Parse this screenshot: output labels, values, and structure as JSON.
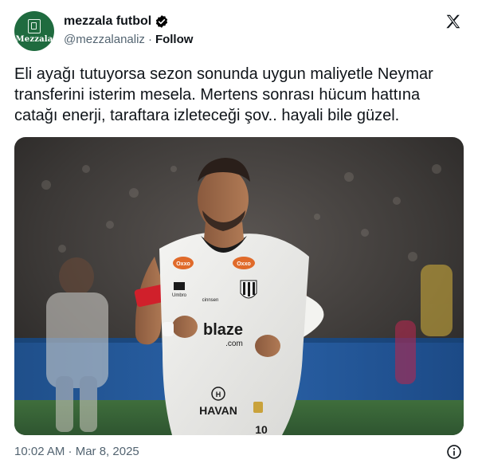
{
  "author": {
    "display_name": "mezzala futbol",
    "handle": "@mezzalanaliz",
    "separator": "·",
    "follow_label": "Follow",
    "avatar_text": "Mezzala",
    "avatar_bg": "#1f6b3f",
    "verified_color": "#000000"
  },
  "tweet": {
    "text": "Eli ayağı tutuyorsa sezon sonunda uygun maliyetle Neymar\ntransferini isterim mesela. Mertens sonrası hücum hattına\ncatağı enerji, taraftara izleteceği şov.. hayali bile güzel."
  },
  "media": {
    "jersey_sponsor": "blaze",
    "jersey_sponsor_sub": ".com",
    "brand_left": "Umbro",
    "brand_right": "cinnsen",
    "shorts_brand": "HAVAN",
    "shorts_logo_letter": "H",
    "badge_text": "Oxxo",
    "shorts_number": "10"
  },
  "footer": {
    "timestamp": "10:02 AM · Mar 8, 2025"
  },
  "icons": [
    "verified-badge-icon",
    "x-logo-icon",
    "info-icon"
  ]
}
